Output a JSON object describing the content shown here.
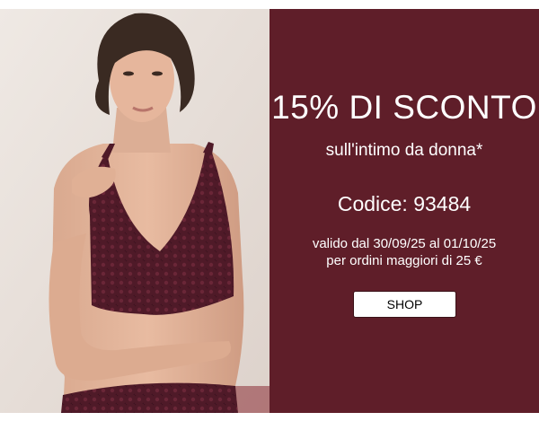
{
  "banner": {
    "headline": "15% DI SCONTO",
    "subtitle": "sull'intimo da donna*",
    "code_text": "Codice: 93484",
    "validity_line1": "valido dal 30/09/25 al 01/10/25",
    "validity_line2": "per ordini maggiori di 25 €",
    "button_label": "SHOP"
  },
  "colors": {
    "panel_background": "#5f1e29",
    "text": "#ffffff",
    "button_background": "#ffffff",
    "button_text": "#000000",
    "lingerie": "#4f1a28"
  }
}
